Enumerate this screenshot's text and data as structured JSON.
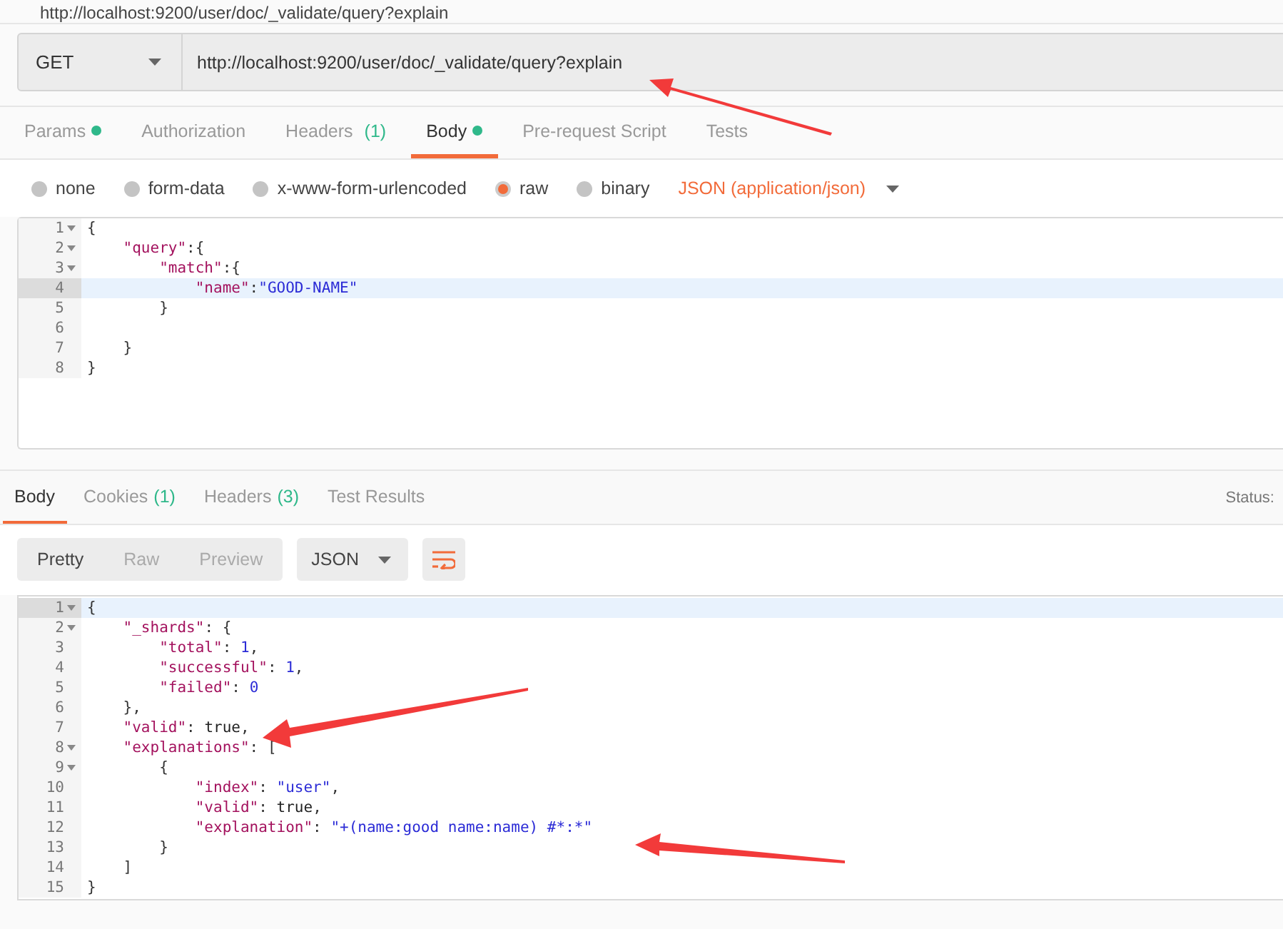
{
  "tab_title": "http://localhost:9200/user/doc/_validate/query?explain",
  "request": {
    "method": "GET",
    "url": "http://localhost:9200/user/doc/_validate/query?explain"
  },
  "request_tabs": [
    {
      "label": "Params",
      "dot": true,
      "selected": false
    },
    {
      "label": "Authorization",
      "dot": false,
      "selected": false
    },
    {
      "label": "Headers",
      "count": "(1)",
      "dot": false,
      "selected": false
    },
    {
      "label": "Body",
      "dot": true,
      "selected": true
    },
    {
      "label": "Pre-request Script",
      "dot": false,
      "selected": false
    },
    {
      "label": "Tests",
      "dot": false,
      "selected": false
    }
  ],
  "body_types": [
    {
      "label": "none",
      "selected": false
    },
    {
      "label": "form-data",
      "selected": false
    },
    {
      "label": "x-www-form-urlencoded",
      "selected": false
    },
    {
      "label": "raw",
      "selected": true
    },
    {
      "label": "binary",
      "selected": false
    }
  ],
  "content_type": "JSON (application/json)",
  "request_body": [
    {
      "n": "1",
      "fold": true,
      "active": false,
      "tokens": [
        {
          "kind": "punct",
          "text": "{"
        }
      ]
    },
    {
      "n": "2",
      "fold": true,
      "active": false,
      "tokens": [
        {
          "kind": "key",
          "text": "    \"query\""
        },
        {
          "kind": "punct",
          "text": ":{"
        }
      ]
    },
    {
      "n": "3",
      "fold": true,
      "active": false,
      "tokens": [
        {
          "kind": "key",
          "text": "        \"match\""
        },
        {
          "kind": "punct",
          "text": ":{"
        }
      ]
    },
    {
      "n": "4",
      "fold": false,
      "active": true,
      "tokens": [
        {
          "kind": "key",
          "text": "            \"name\""
        },
        {
          "kind": "punct",
          "text": ":"
        },
        {
          "kind": "str",
          "text": "\"GOOD-NAME\""
        }
      ]
    },
    {
      "n": "5",
      "fold": false,
      "active": false,
      "tokens": [
        {
          "kind": "punct",
          "text": "        }"
        }
      ]
    },
    {
      "n": "6",
      "fold": false,
      "active": false
    },
    {
      "n": "7",
      "fold": false,
      "active": false,
      "tokens": [
        {
          "kind": "punct",
          "text": "    }"
        }
      ]
    },
    {
      "n": "8",
      "fold": false,
      "active": false,
      "tokens": [
        {
          "kind": "punct",
          "text": "}"
        }
      ]
    }
  ],
  "response_tabs": [
    {
      "label": "Body",
      "selected": true
    },
    {
      "label": "Cookies",
      "count": "(1)",
      "selected": false
    },
    {
      "label": "Headers",
      "count": "(3)",
      "selected": false
    },
    {
      "label": "Test Results",
      "selected": false
    }
  ],
  "status_label": "Status:",
  "view_modes": [
    {
      "label": "Pretty",
      "selected": true
    },
    {
      "label": "Raw",
      "selected": false
    },
    {
      "label": "Preview",
      "selected": false
    }
  ],
  "format": "JSON",
  "response_body": [
    {
      "n": "1",
      "fold": true,
      "active": true,
      "tokens": [
        {
          "kind": "punct",
          "text": "{"
        }
      ]
    },
    {
      "n": "2",
      "fold": true,
      "active": false,
      "tokens": [
        {
          "kind": "key",
          "text": "    \"_shards\""
        },
        {
          "kind": "punct",
          "text": ": {"
        }
      ]
    },
    {
      "n": "3",
      "fold": false,
      "active": false,
      "tokens": [
        {
          "kind": "key",
          "text": "        \"total\""
        },
        {
          "kind": "punct",
          "text": ": "
        },
        {
          "kind": "num",
          "text": "1"
        },
        {
          "kind": "punct",
          "text": ","
        }
      ]
    },
    {
      "n": "4",
      "fold": false,
      "active": false,
      "tokens": [
        {
          "kind": "key",
          "text": "        \"successful\""
        },
        {
          "kind": "punct",
          "text": ": "
        },
        {
          "kind": "num",
          "text": "1"
        },
        {
          "kind": "punct",
          "text": ","
        }
      ]
    },
    {
      "n": "5",
      "fold": false,
      "active": false,
      "tokens": [
        {
          "kind": "key",
          "text": "        \"failed\""
        },
        {
          "kind": "punct",
          "text": ": "
        },
        {
          "kind": "num",
          "text": "0"
        }
      ]
    },
    {
      "n": "6",
      "fold": false,
      "active": false,
      "tokens": [
        {
          "kind": "punct",
          "text": "    },"
        }
      ]
    },
    {
      "n": "7",
      "fold": false,
      "active": false,
      "tokens": [
        {
          "kind": "key",
          "text": "    \"valid\""
        },
        {
          "kind": "punct",
          "text": ": "
        },
        {
          "kind": "bool",
          "text": "true"
        },
        {
          "kind": "punct",
          "text": ","
        }
      ]
    },
    {
      "n": "8",
      "fold": true,
      "active": false,
      "tokens": [
        {
          "kind": "key",
          "text": "    \"explanations\""
        },
        {
          "kind": "punct",
          "text": ": ["
        }
      ]
    },
    {
      "n": "9",
      "fold": true,
      "active": false,
      "tokens": [
        {
          "kind": "punct",
          "text": "        {"
        }
      ]
    },
    {
      "n": "10",
      "fold": false,
      "active": false,
      "tokens": [
        {
          "kind": "key",
          "text": "            \"index\""
        },
        {
          "kind": "punct",
          "text": ": "
        },
        {
          "kind": "str",
          "text": "\"user\""
        },
        {
          "kind": "punct",
          "text": ","
        }
      ]
    },
    {
      "n": "11",
      "fold": false,
      "active": false,
      "tokens": [
        {
          "kind": "key",
          "text": "            \"valid\""
        },
        {
          "kind": "punct",
          "text": ": "
        },
        {
          "kind": "bool",
          "text": "true"
        },
        {
          "kind": "punct",
          "text": ","
        }
      ]
    },
    {
      "n": "12",
      "fold": false,
      "active": false,
      "tokens": [
        {
          "kind": "key",
          "text": "            \"explanation\""
        },
        {
          "kind": "punct",
          "text": ": "
        },
        {
          "kind": "str",
          "text": "\"+(name:good name:name) #*:*\""
        }
      ]
    },
    {
      "n": "13",
      "fold": false,
      "active": false,
      "tokens": [
        {
          "kind": "punct",
          "text": "        }"
        }
      ]
    },
    {
      "n": "14",
      "fold": false,
      "active": false,
      "tokens": [
        {
          "kind": "punct",
          "text": "    ]"
        }
      ]
    },
    {
      "n": "15",
      "fold": false,
      "active": false,
      "tokens": [
        {
          "kind": "punct",
          "text": "}"
        }
      ]
    }
  ]
}
